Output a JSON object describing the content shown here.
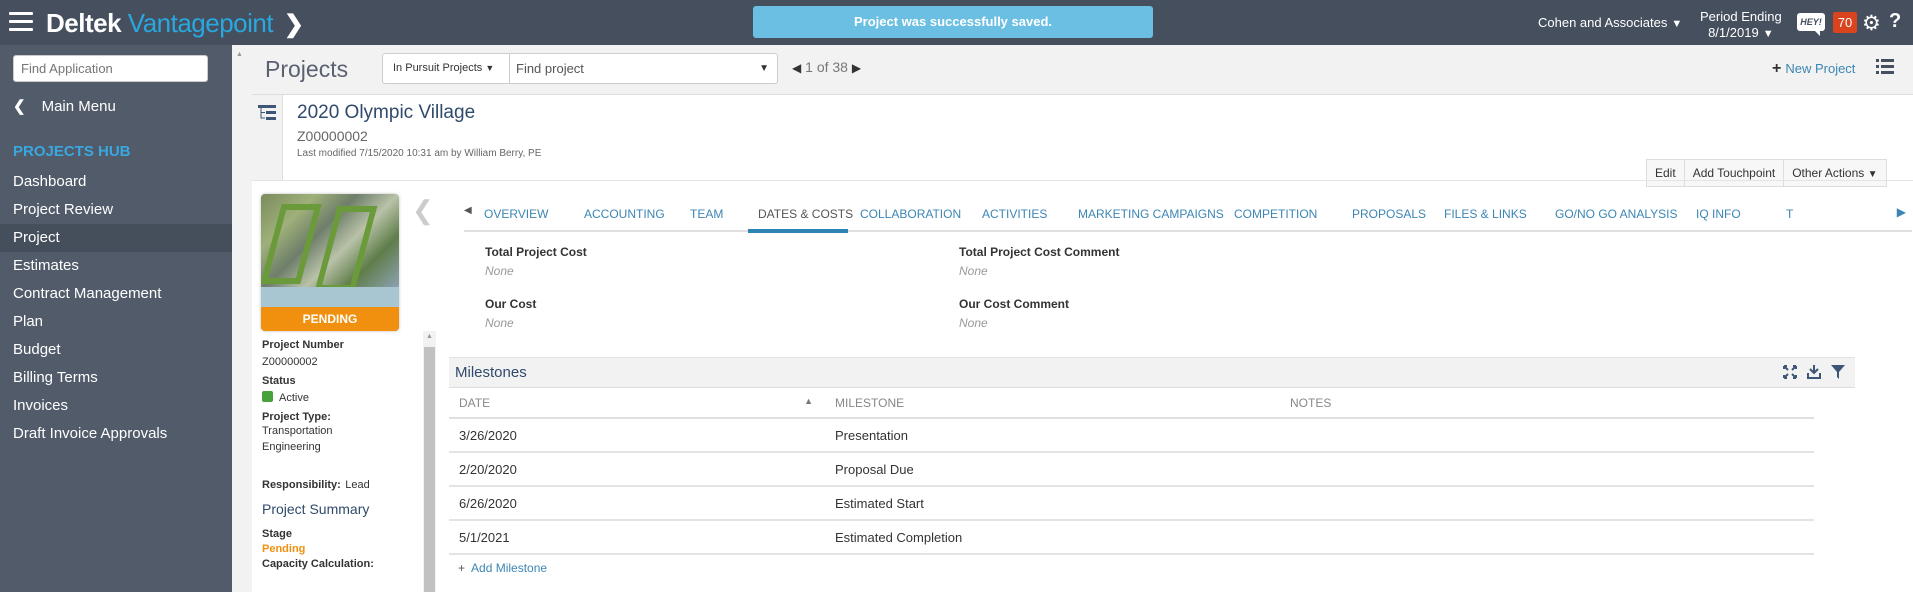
{
  "topbar": {
    "brand_primary": "Deltek",
    "brand_secondary": "Vantagepoint",
    "brand_chevron": "❯",
    "toast": "Project was successfully saved.",
    "company": "Cohen and Associates",
    "period_label": "Period Ending",
    "period_value": "8/1/2019",
    "hey_label": "HEY!",
    "notification_count": "70",
    "dropdown_glyph": "▼"
  },
  "sidebar": {
    "find_placeholder": "Find Application",
    "main_menu": "Main Menu",
    "hub_title": "PROJECTS HUB",
    "items": [
      {
        "label": "Dashboard"
      },
      {
        "label": "Project Review"
      },
      {
        "label": "Project",
        "active": true
      },
      {
        "label": "Estimates"
      },
      {
        "label": "Contract Management"
      },
      {
        "label": "Plan"
      },
      {
        "label": "Budget"
      },
      {
        "label": "Billing Terms"
      },
      {
        "label": "Invoices"
      },
      {
        "label": "Draft Invoice Approvals"
      }
    ]
  },
  "header": {
    "title": "Projects",
    "filter": "In Pursuit Projects",
    "find_placeholder": "Find project",
    "pager_current": "1",
    "pager_of": "of",
    "pager_total": "38",
    "new_project": "New Project"
  },
  "record": {
    "name": "2020 Olympic Village",
    "id": "Z00000002",
    "last_modified": "Last modified 7/15/2020 10:31 am by William Berry, PE",
    "actions": [
      "Edit",
      "Add Touchpoint",
      "Other Actions"
    ]
  },
  "info_panel": {
    "stage_badge": "PENDING",
    "project_number_label": "Project Number",
    "project_number": "Z00000002",
    "status_label": "Status",
    "status": "Active",
    "status_color": "#48a23b",
    "project_type_label": "Project Type:",
    "project_type_line1": "Transportation",
    "project_type_line2": "Engineering",
    "responsibility_label": "Responsibility:",
    "responsibility": "Lead",
    "summary_title": "Project Summary",
    "stage_label": "Stage",
    "stage": "Pending",
    "capacity_label": "Capacity Calculation:"
  },
  "tabs": [
    {
      "label": "OVERVIEW"
    },
    {
      "label": "ACCOUNTING"
    },
    {
      "label": "TEAM"
    },
    {
      "label": "DATES & COSTS",
      "active": true
    },
    {
      "label": "COLLABORATION"
    },
    {
      "label": "ACTIVITIES"
    },
    {
      "label": "MARKETING CAMPAIGNS"
    },
    {
      "label": "COMPETITION"
    },
    {
      "label": "PROPOSALS"
    },
    {
      "label": "FILES & LINKS"
    },
    {
      "label": "GO/NO GO ANALYSIS"
    },
    {
      "label": "IQ INFO"
    },
    {
      "label": "T"
    }
  ],
  "fields": {
    "total_cost_label": "Total Project Cost",
    "total_cost_value": "None",
    "total_cost_comment_label": "Total Project Cost Comment",
    "total_cost_comment_value": "None",
    "our_cost_label": "Our Cost",
    "our_cost_value": "None",
    "our_cost_comment_label": "Our Cost Comment",
    "our_cost_comment_value": "None"
  },
  "milestones": {
    "title": "Milestones",
    "columns": [
      "DATE",
      "MILESTONE",
      "NOTES"
    ],
    "rows": [
      {
        "date": "3/26/2020",
        "milestone": "Presentation",
        "notes": ""
      },
      {
        "date": "2/20/2020",
        "milestone": "Proposal Due",
        "notes": ""
      },
      {
        "date": "6/26/2020",
        "milestone": "Estimated Start",
        "notes": ""
      },
      {
        "date": "5/1/2021",
        "milestone": "Estimated Completion",
        "notes": ""
      }
    ],
    "add_label": "Add Milestone"
  },
  "colors": {
    "topbar": "#454f5e",
    "sidebar": "#515b6a",
    "accent_blue": "#29a8e0",
    "link_blue": "#3b86b4",
    "pending_orange": "#f0900e",
    "toast": "#6bbfe3",
    "badge_red": "#d9431e"
  }
}
